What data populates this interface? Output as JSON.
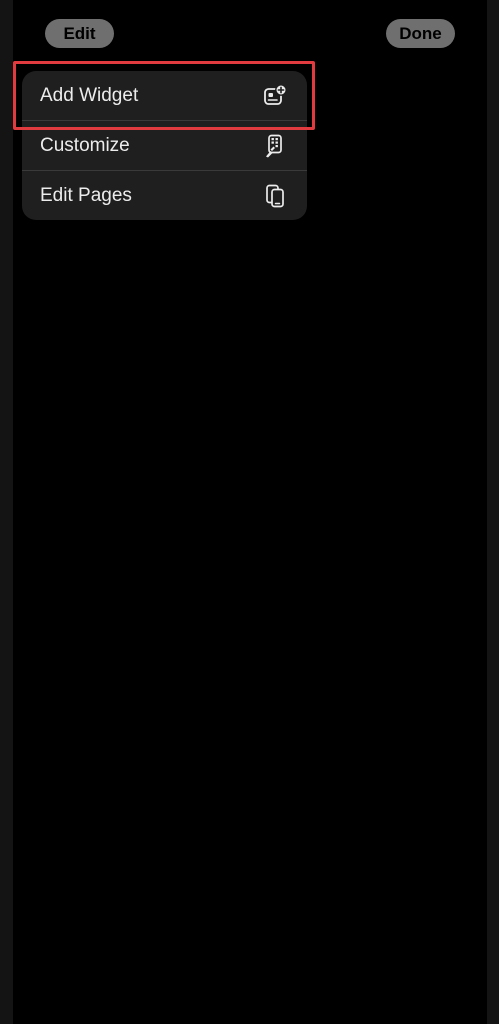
{
  "header": {
    "edit_label": "Edit",
    "done_label": "Done"
  },
  "menu": {
    "items": [
      {
        "label": "Add Widget",
        "icon": "add-widget-icon"
      },
      {
        "label": "Customize",
        "icon": "customize-icon"
      },
      {
        "label": "Edit Pages",
        "icon": "edit-pages-icon"
      }
    ]
  },
  "colors": {
    "background": "#000000",
    "menu_background": "#1f1f1f",
    "pill_background": "#6f6f6f",
    "highlight": "#e23b3f"
  }
}
